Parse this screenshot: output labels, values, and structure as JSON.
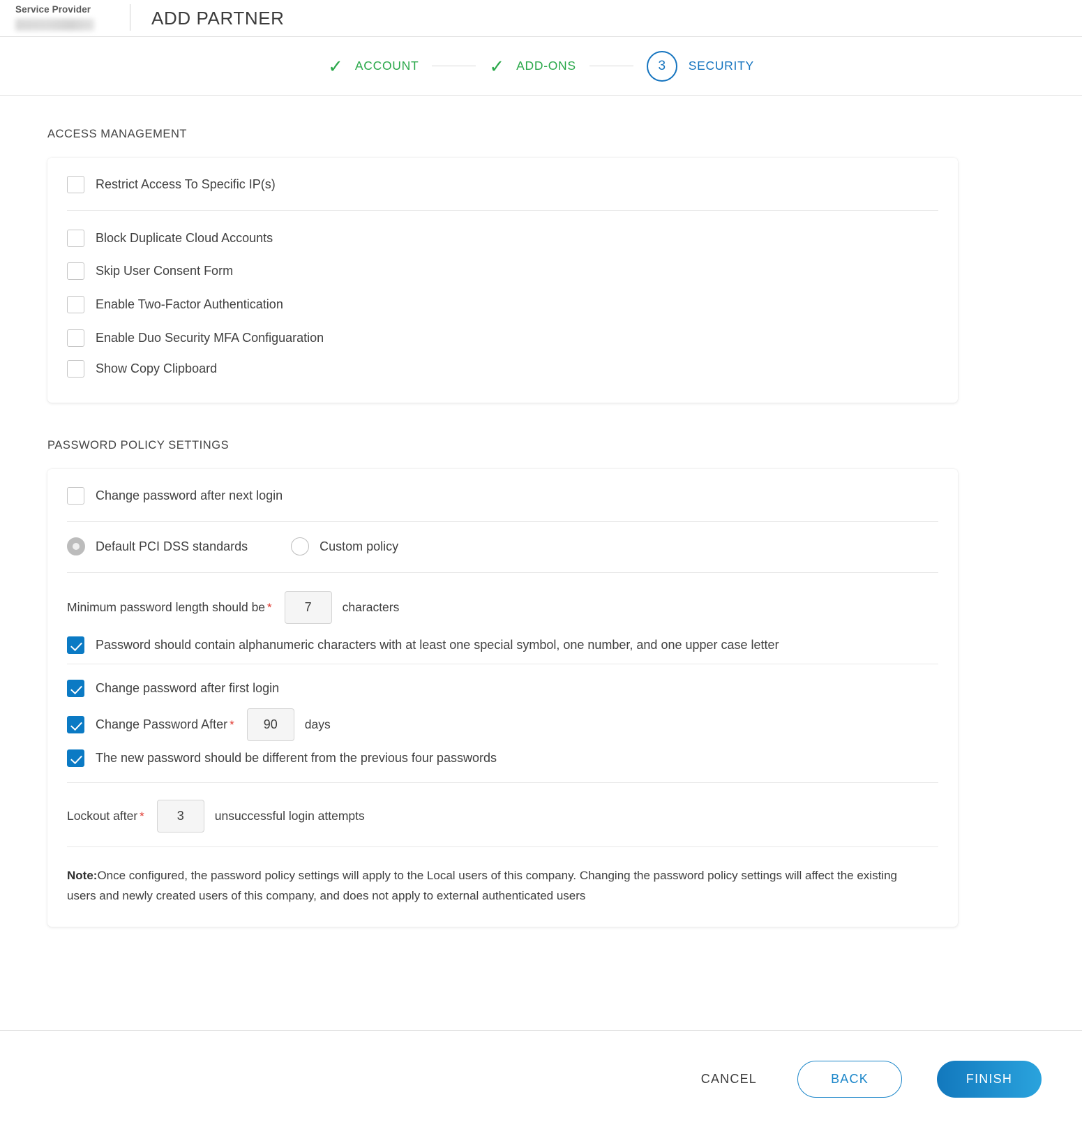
{
  "header": {
    "service_provider_label": "Service Provider",
    "page_title": "ADD PARTNER"
  },
  "stepper": {
    "steps": [
      {
        "label": "ACCOUNT",
        "state": "done",
        "marker": "check"
      },
      {
        "label": "ADD-ONS",
        "state": "done",
        "marker": "check"
      },
      {
        "label": "SECURITY",
        "state": "active",
        "marker": "3"
      }
    ],
    "colors": {
      "done": "#2aa84a",
      "active": "#1574bf"
    }
  },
  "access_management": {
    "title": "ACCESS MANAGEMENT",
    "items": [
      {
        "label": "Restrict Access To Specific IP(s)",
        "checked": false
      },
      {
        "label": "Block Duplicate Cloud Accounts",
        "checked": false
      },
      {
        "label": "Skip User Consent Form",
        "checked": false
      },
      {
        "label": "Enable Two-Factor Authentication",
        "checked": false
      },
      {
        "label": "Enable Duo Security MFA Configuaration",
        "checked": false
      },
      {
        "label": "Show Copy Clipboard",
        "checked": false
      }
    ]
  },
  "password_policy": {
    "title": "PASSWORD POLICY SETTINGS",
    "change_after_next_login": {
      "label": "Change password after next login",
      "checked": false
    },
    "policy_mode": {
      "options": [
        {
          "label": "Default PCI DSS standards",
          "selected": true
        },
        {
          "label": "Custom policy",
          "selected": false
        }
      ]
    },
    "min_length": {
      "label": "Minimum password length should be",
      "required_marker": "*",
      "value": "7",
      "suffix": "characters"
    },
    "alphanumeric": {
      "label": "Password should contain alphanumeric characters with at least one special symbol, one number, and one upper case letter",
      "checked": true
    },
    "change_after_first_login": {
      "label": "Change password after first login",
      "checked": true
    },
    "change_password_after": {
      "label": "Change Password After",
      "required_marker": "*",
      "value": "90",
      "suffix": "days",
      "checked": true
    },
    "different_from_previous": {
      "label": "The new password should be different from the previous four passwords",
      "checked": true
    },
    "lockout": {
      "label": "Lockout after",
      "required_marker": "*",
      "value": "3",
      "suffix": "unsuccessful login attempts"
    },
    "note": {
      "prefix": "Note:",
      "text": "Once configured, the password policy settings will apply to the Local users of this company. Changing the password policy settings will affect the existing users and newly created users of this company, and does not apply to external authenticated users"
    }
  },
  "footer": {
    "cancel_label": "CANCEL",
    "back_label": "BACK",
    "finish_label": "FINISH",
    "accent": "#1b86c9"
  }
}
